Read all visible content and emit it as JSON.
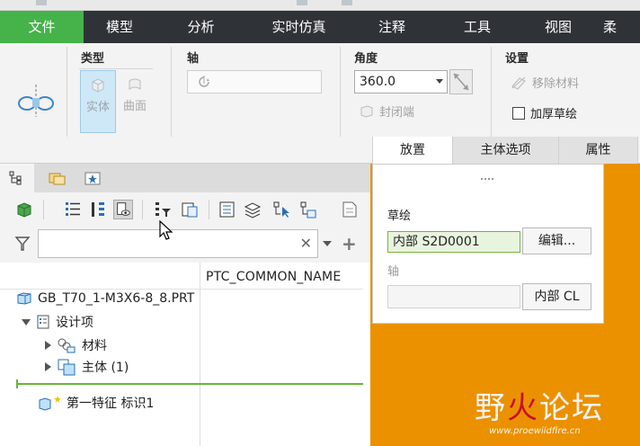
{
  "menu": {
    "items": [
      {
        "key": "file",
        "label": "文件"
      },
      {
        "key": "model",
        "label": "模型"
      },
      {
        "key": "analysis",
        "label": "分析"
      },
      {
        "key": "sim",
        "label": "实时仿真"
      },
      {
        "key": "note",
        "label": "注释"
      },
      {
        "key": "tools",
        "label": "工具"
      },
      {
        "key": "view",
        "label": "视图"
      },
      {
        "key": "more",
        "label": "柔"
      }
    ],
    "active": "file"
  },
  "ribbon": {
    "type_group": {
      "title": "类型",
      "solid": "实体",
      "surface": "曲面"
    },
    "axis_group": {
      "title": "轴"
    },
    "angle_group": {
      "title": "角度",
      "value": "360.0",
      "close_ends": "封闭端"
    },
    "settings_group": {
      "title": "设置",
      "remove_material": "移除材料",
      "thicken_sketch": "加厚草绘"
    }
  },
  "panel_tabs": {
    "placement": "放置",
    "options": "主体选项",
    "properties": "属性"
  },
  "placement_panel": {
    "sketch_label": "草绘",
    "sketch_value": "内部 S2D0001",
    "edit_button": "编辑...",
    "axis_label": "轴",
    "axis_value": "",
    "axis_button": "内部 CL"
  },
  "tree": {
    "filter_placeholder": "",
    "column_header": "PTC_COMMON_NAME",
    "rows": {
      "root": "GB_T70_1-M3X6-8_8.PRT",
      "design_items": "设计项",
      "material": "材料",
      "bodies": "主体 (1)",
      "feature": "第一特征 标识1"
    }
  },
  "watermark": {
    "text_a": "野",
    "text_flame": "火",
    "text_b": "论坛",
    "url": "www.proewildfire.cn"
  },
  "colors": {
    "menu_bg": "#2f3338",
    "menu_active": "#46b24a",
    "graphics_bg": "#eb9100",
    "selection": "#cfe8f7",
    "sketch_field": "#e9f4df"
  }
}
